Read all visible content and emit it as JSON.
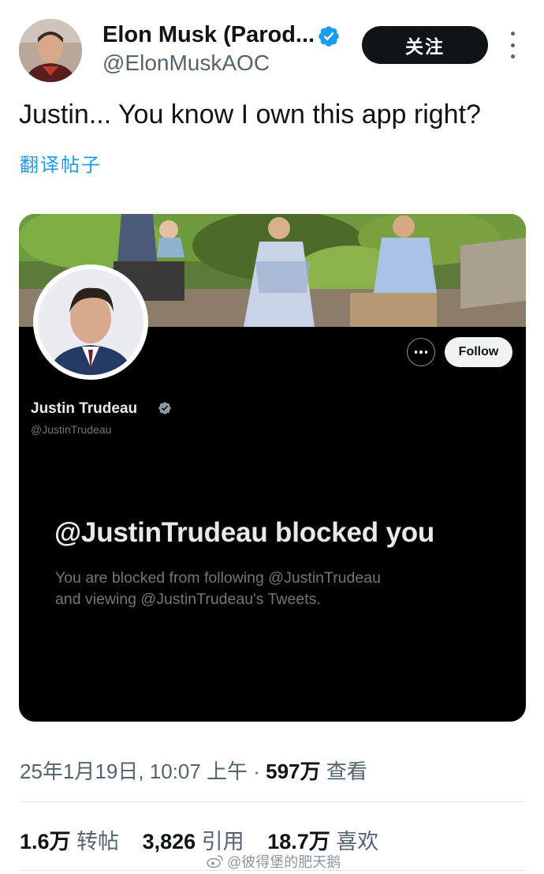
{
  "author": {
    "display_name": "Elon Musk (Parod...",
    "handle": "@ElonMuskAOC",
    "follow_label": "关注"
  },
  "tweet": {
    "text": "Justin... You know I own this app right?",
    "translate_label": "翻译帖子"
  },
  "embedded_profile": {
    "name": "Justin Trudeau",
    "handle": "@JustinTrudeau",
    "follow_label": "Follow",
    "blocked_title": "@JustinTrudeau blocked you",
    "blocked_line_1": "You are blocked from following @JustinTrudeau",
    "blocked_line_2": "and viewing @JustinTrudeau's Tweets."
  },
  "meta": {
    "datetime": "25年1月19日, 10:07 上午 · ",
    "views_count": "597万",
    "views_label": " 查看"
  },
  "stats": {
    "retweets_count": "1.6万",
    "retweets_label": " 转帖",
    "quotes_count": "3,826",
    "quotes_label": " 引用",
    "likes_count": "18.7万",
    "likes_label": " 喜欢"
  },
  "watermark": "@彼得堡的肥天鹅",
  "colors": {
    "accent": "#1d9bf0",
    "text_primary": "#0f1419",
    "text_secondary": "#536471"
  },
  "icons": [
    "verified-badge-icon",
    "more-vertical-icon",
    "more-horizontal-icon",
    "weibo-icon"
  ]
}
